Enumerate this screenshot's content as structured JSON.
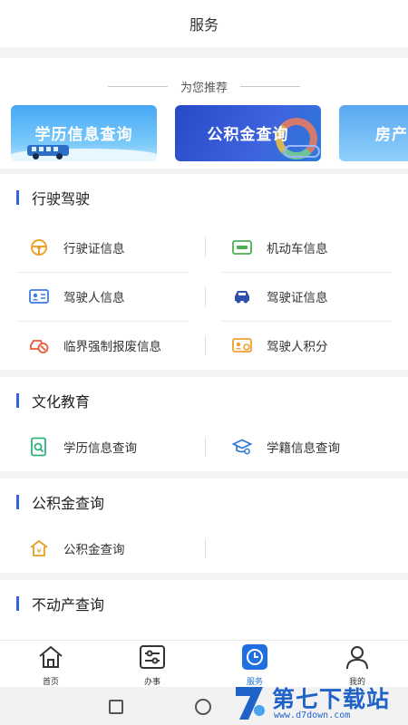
{
  "header": {
    "title": "服务"
  },
  "recommend": {
    "heading": "为您推荐",
    "banners": [
      {
        "label": "学历信息查询"
      },
      {
        "label": "公积金查询"
      },
      {
        "label": "房产"
      }
    ]
  },
  "sections": [
    {
      "title": "行驶驾驶",
      "items": [
        {
          "label": "行驶证信息",
          "icon": "steering-wheel-icon"
        },
        {
          "label": "机动车信息",
          "icon": "vehicle-card-icon"
        },
        {
          "label": "驾驶人信息",
          "icon": "id-card-icon"
        },
        {
          "label": "驾驶证信息",
          "icon": "car-icon"
        },
        {
          "label": "临界强制报废信息",
          "icon": "scrap-car-icon"
        },
        {
          "label": "驾驶人积分",
          "icon": "score-card-icon"
        }
      ]
    },
    {
      "title": "文化教育",
      "items": [
        {
          "label": "学历信息查询",
          "icon": "document-search-icon"
        },
        {
          "label": "学籍信息查询",
          "icon": "graduation-cap-icon"
        }
      ]
    },
    {
      "title": "公积金查询",
      "items": [
        {
          "label": "公积金查询",
          "icon": "house-fund-icon"
        }
      ]
    },
    {
      "title": "不动产查询",
      "items": []
    }
  ],
  "tabbar": {
    "tabs": [
      {
        "label": "首页",
        "icon": "home-icon"
      },
      {
        "label": "办事",
        "icon": "sliders-icon"
      },
      {
        "label": "服务",
        "icon": "clock-icon"
      },
      {
        "label": "我的",
        "icon": "user-icon"
      }
    ],
    "active": "服务"
  },
  "watermark": {
    "text": "第七下载站",
    "url": "www.d7down.com"
  },
  "colors": {
    "accent": "#3563e0",
    "tab_active": "#1f6fe0",
    "watermark": "#1f63c9"
  }
}
